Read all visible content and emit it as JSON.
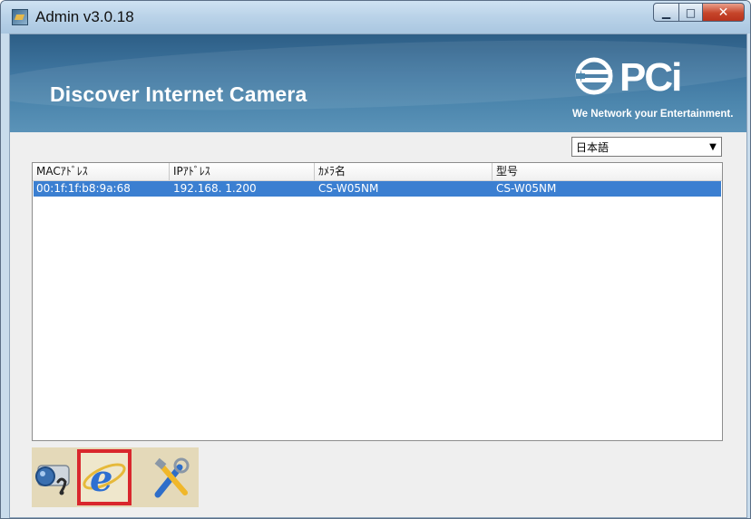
{
  "window": {
    "title": "Admin v3.0.18",
    "controls": {
      "minimize": "▁",
      "maximize": "□",
      "close": "✕"
    }
  },
  "banner": {
    "title": "Discover Internet Camera",
    "tagline": "We Network your Entertainment.",
    "logo_text": "PCi"
  },
  "language": {
    "selected": "日本語",
    "arrow": "▼"
  },
  "table": {
    "columns": [
      "MACｱﾄﾞﾚｽ",
      "IPｱﾄﾞﾚｽ",
      "ｶﾒﾗ名",
      "型号"
    ],
    "rows": [
      [
        "00:1f:1f:b8:9a:68",
        "192.168.  1.200",
        "CS-W05NM",
        "CS-W05NM"
      ]
    ]
  },
  "toolbar": {
    "buttons": [
      {
        "name": "camera-search-icon",
        "selected": false
      },
      {
        "name": "internet-explorer-icon",
        "selected": true
      },
      {
        "name": "settings-tools-icon",
        "selected": false
      }
    ]
  },
  "colors": {
    "selection": "#3b7fd1",
    "banner": "#3f76a0",
    "highlight_box": "#d9272d",
    "toolbar_bg": "#e4d9b9"
  }
}
